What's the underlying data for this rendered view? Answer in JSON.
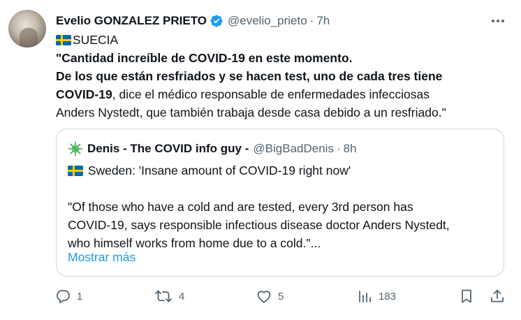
{
  "tweet": {
    "author_name": "Evelio GONZALEZ PRIETO",
    "handle": "@evelio_prieto",
    "separator": "·",
    "time": "7h",
    "country_line": "SUECIA",
    "bold_line1": "\"Cantidad increíble de COVID-19 en este momento.",
    "bold_line2": "De los que están resfriados y se hacen test, uno de cada tres tiene",
    "bold_line3": "COVID-19",
    "tail_line3": ", dice el médico responsable de enfermedades infecciosas",
    "line4": "Anders Nystedt, que también trabaja desde casa debido a un resfriado.\""
  },
  "quote": {
    "author_name": "Denis - The COVID info guy -",
    "handle": "@BigBadDenis",
    "separator": "·",
    "time": "8h",
    "headline": "Sweden: 'Insane amount of COVID-19 right now'",
    "paragraph": "\"Of those who have a cold and are tested, every 3rd person has\nCOVID-19, says responsible infectious disease doctor Anders Nystedt,\nwho himself works from home due to a cold.\"...",
    "show_more": "Mostrar más"
  },
  "actions": {
    "replies": "1",
    "retweets": "4",
    "likes": "5",
    "views": "183"
  },
  "icons": {
    "verified": "verified-badge-icon",
    "more": "more-icon",
    "flag": "sweden-flag-icon",
    "virus": "virus-icon",
    "reply": "reply-icon",
    "retweet": "retweet-icon",
    "like": "heart-icon",
    "views": "views-icon",
    "bookmark": "bookmark-icon",
    "share": "share-icon"
  },
  "colors": {
    "text": "#0f1419",
    "secondary": "#536471",
    "link": "#1d9bf0",
    "border": "#cfd9de"
  }
}
